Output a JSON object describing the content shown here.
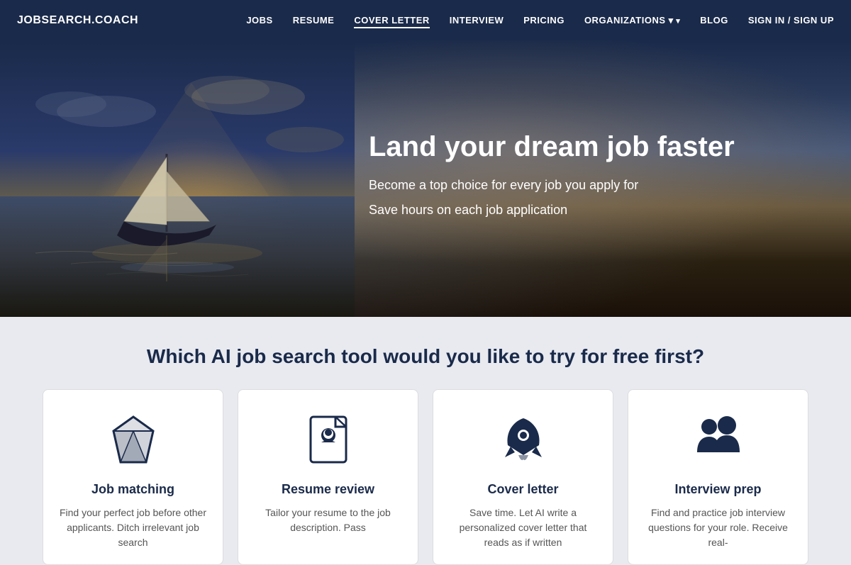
{
  "brand": "JOBSEARCH.COACH",
  "nav": {
    "links": [
      {
        "label": "JOBS",
        "id": "jobs",
        "active": false,
        "hasArrow": false
      },
      {
        "label": "RESUME",
        "id": "resume",
        "active": false,
        "hasArrow": false
      },
      {
        "label": "COVER LETTER",
        "id": "cover-letter",
        "active": true,
        "hasArrow": false
      },
      {
        "label": "INTERVIEW",
        "id": "interview",
        "active": false,
        "hasArrow": false
      },
      {
        "label": "PRICING",
        "id": "pricing",
        "active": false,
        "hasArrow": false
      },
      {
        "label": "ORGANIZATIONS",
        "id": "organizations",
        "active": false,
        "hasArrow": true
      },
      {
        "label": "BLOG",
        "id": "blog",
        "active": false,
        "hasArrow": false
      },
      {
        "label": "SIGN IN / SIGN UP",
        "id": "signin",
        "active": false,
        "hasArrow": false
      }
    ]
  },
  "hero": {
    "headline": "Land your dream job faster",
    "subline1": "Become a top choice for every job you apply for",
    "subline2": "Save hours on each job application"
  },
  "tools": {
    "section_title": "Which AI job search tool would you like to try for free first?",
    "cards": [
      {
        "id": "job-matching",
        "title": "Job matching",
        "description": "Find your perfect job before other applicants. Ditch irrelevant job search",
        "icon": "diamond"
      },
      {
        "id": "resume-review",
        "title": "Resume review",
        "description": "Tailor your resume to the job description. Pass",
        "icon": "resume"
      },
      {
        "id": "cover-letter",
        "title": "Cover letter",
        "description": "Save time. Let AI write a personalized cover letter that reads as if written",
        "icon": "rocket"
      },
      {
        "id": "interview-prep",
        "title": "Interview prep",
        "description": "Find and practice job interview questions for your role. Receive real-",
        "icon": "people"
      }
    ]
  }
}
